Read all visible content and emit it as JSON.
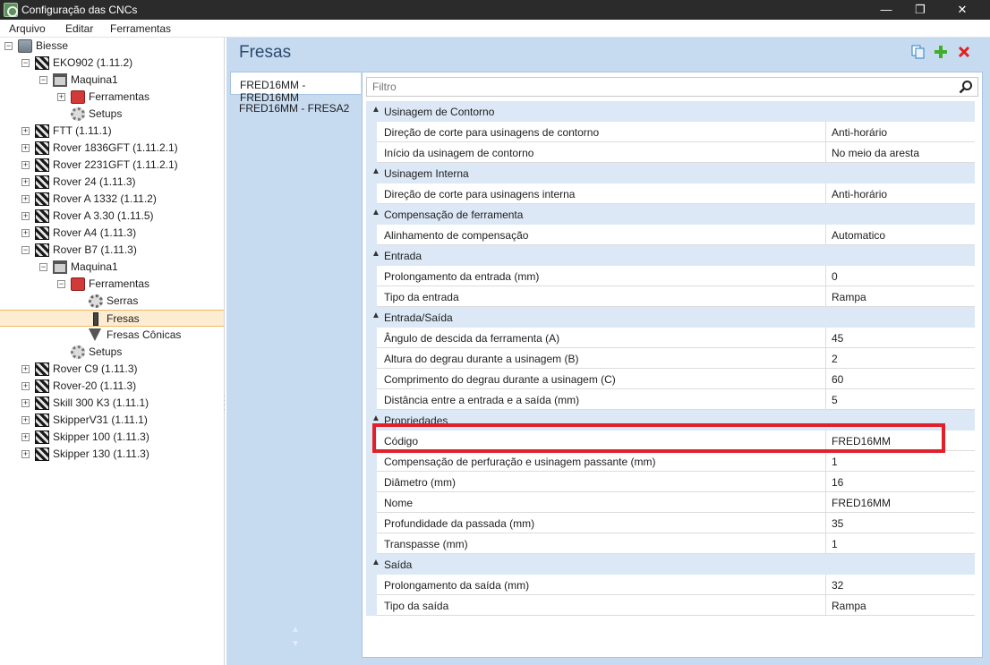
{
  "window": {
    "title": "Configuração das CNCs",
    "controls": {
      "minimize": "—",
      "maximize": "❐",
      "close": "✕"
    }
  },
  "menu": [
    "Arquivo",
    "Editar",
    "Ferramentas"
  ],
  "tree": [
    {
      "label": "Biesse",
      "level": 0,
      "icon": "folder-icon",
      "expander": "−"
    },
    {
      "label": "EKO902 (1.11.2)",
      "level": 1,
      "icon": "cnc-icon",
      "expander": "−"
    },
    {
      "label": "Maquina1",
      "level": 2,
      "icon": "machine-icon",
      "expander": "−"
    },
    {
      "label": "Ferramentas",
      "level": 3,
      "icon": "toolbox-icon",
      "expander": "+"
    },
    {
      "label": "Setups",
      "level": 3,
      "icon": "gear-icon",
      "expander": ""
    },
    {
      "label": "FTT (1.11.1)",
      "level": 1,
      "icon": "cnc-icon",
      "expander": "+"
    },
    {
      "label": "Rover 1836GFT (1.11.2.1)",
      "level": 1,
      "icon": "cnc-icon",
      "expander": "+"
    },
    {
      "label": "Rover 2231GFT (1.11.2.1)",
      "level": 1,
      "icon": "cnc-icon",
      "expander": "+"
    },
    {
      "label": "Rover 24 (1.11.3)",
      "level": 1,
      "icon": "cnc-icon",
      "expander": "+"
    },
    {
      "label": "Rover A 1332 (1.11.2)",
      "level": 1,
      "icon": "cnc-icon",
      "expander": "+"
    },
    {
      "label": "Rover A 3.30 (1.11.5)",
      "level": 1,
      "icon": "cnc-icon",
      "expander": "+"
    },
    {
      "label": "Rover A4 (1.11.3)",
      "level": 1,
      "icon": "cnc-icon",
      "expander": "+"
    },
    {
      "label": "Rover B7 (1.11.3)",
      "level": 1,
      "icon": "cnc-icon",
      "expander": "−"
    },
    {
      "label": "Maquina1",
      "level": 2,
      "icon": "machine-icon",
      "expander": "−"
    },
    {
      "label": "Ferramentas",
      "level": 3,
      "icon": "toolbox-icon",
      "expander": "−"
    },
    {
      "label": "Serras",
      "level": 4,
      "icon": "saw-icon",
      "expander": ""
    },
    {
      "label": "Fresas",
      "level": 4,
      "icon": "mill-icon",
      "expander": "",
      "selected": true
    },
    {
      "label": "Fresas Cônicas",
      "level": 4,
      "icon": "cone-icon",
      "expander": ""
    },
    {
      "label": "Setups",
      "level": 3,
      "icon": "gear-icon",
      "expander": ""
    },
    {
      "label": "Rover C9 (1.11.3)",
      "level": 1,
      "icon": "cnc-icon",
      "expander": "+"
    },
    {
      "label": "Rover-20 (1.11.3)",
      "level": 1,
      "icon": "cnc-icon",
      "expander": "+"
    },
    {
      "label": "Skill 300 K3 (1.11.1)",
      "level": 1,
      "icon": "cnc-icon",
      "expander": "+"
    },
    {
      "label": "SkipperV31 (1.11.1)",
      "level": 1,
      "icon": "cnc-icon",
      "expander": "+"
    },
    {
      "label": "Skipper 100 (1.11.3)",
      "level": 1,
      "icon": "cnc-icon",
      "expander": "+"
    },
    {
      "label": "Skipper 130 (1.11.3)",
      "level": 1,
      "icon": "cnc-icon",
      "expander": "+"
    }
  ],
  "main": {
    "title": "Fresas",
    "toolbar_icons": [
      "copy-icon",
      "add-icon",
      "delete-icon"
    ],
    "tools": [
      {
        "label": "FRED16MM - FRED16MM",
        "active": true
      },
      {
        "label": "FRED16MM - FRESA2",
        "active": false
      }
    ],
    "filter_placeholder": "Filtro",
    "categories": [
      {
        "name": "Usinagem de Contorno",
        "props": [
          {
            "name": "Direção de corte para usinagens de contorno",
            "value": "Anti-horário"
          },
          {
            "name": "Início da usinagem de contorno",
            "value": "No meio da aresta"
          }
        ]
      },
      {
        "name": "Usinagem Interna",
        "props": [
          {
            "name": "Direção de corte para usinagens interna",
            "value": "Anti-horário"
          }
        ]
      },
      {
        "name": "Compensação de ferramenta",
        "props": [
          {
            "name": "Alinhamento de compensação",
            "value": "Automatico"
          }
        ]
      },
      {
        "name": "Entrada",
        "props": [
          {
            "name": "Prolongamento da entrada (mm)",
            "value": "0"
          },
          {
            "name": "Tipo da entrada",
            "value": "Rampa"
          }
        ]
      },
      {
        "name": "Entrada/Saída",
        "props": [
          {
            "name": "Ângulo de descida da ferramenta (A)",
            "value": "45"
          },
          {
            "name": "Altura do degrau durante a usinagem (B)",
            "value": "2"
          },
          {
            "name": "Comprimento do degrau durante a usinagem (C)",
            "value": "60"
          },
          {
            "name": "Distância entre a entrada e a saída (mm)",
            "value": "5"
          }
        ]
      },
      {
        "name": "Propriedades",
        "props": [
          {
            "name": "Código",
            "value": "FRED16MM",
            "highlighted": true
          },
          {
            "name": "Compensação de perfuração e usinagem passante (mm)",
            "value": "1"
          },
          {
            "name": "Diâmetro (mm)",
            "value": "16"
          },
          {
            "name": "Nome",
            "value": "FRED16MM"
          },
          {
            "name": "Profundidade da passada (mm)",
            "value": "35"
          },
          {
            "name": "Transpasse (mm)",
            "value": "1"
          }
        ]
      },
      {
        "name": "Saída",
        "props": [
          {
            "name": "Prolongamento da saída (mm)",
            "value": "32"
          },
          {
            "name": "Tipo da saída",
            "value": "Rampa"
          }
        ]
      }
    ]
  },
  "colors": {
    "titlebar": "#2b2b2b",
    "pane_bg": "#c6daf0",
    "category_bg": "#dce8f6",
    "selection": "#fcecd2",
    "highlight_box": "#e0202a",
    "add_green": "#3fae29",
    "delete_red": "#e02020"
  }
}
